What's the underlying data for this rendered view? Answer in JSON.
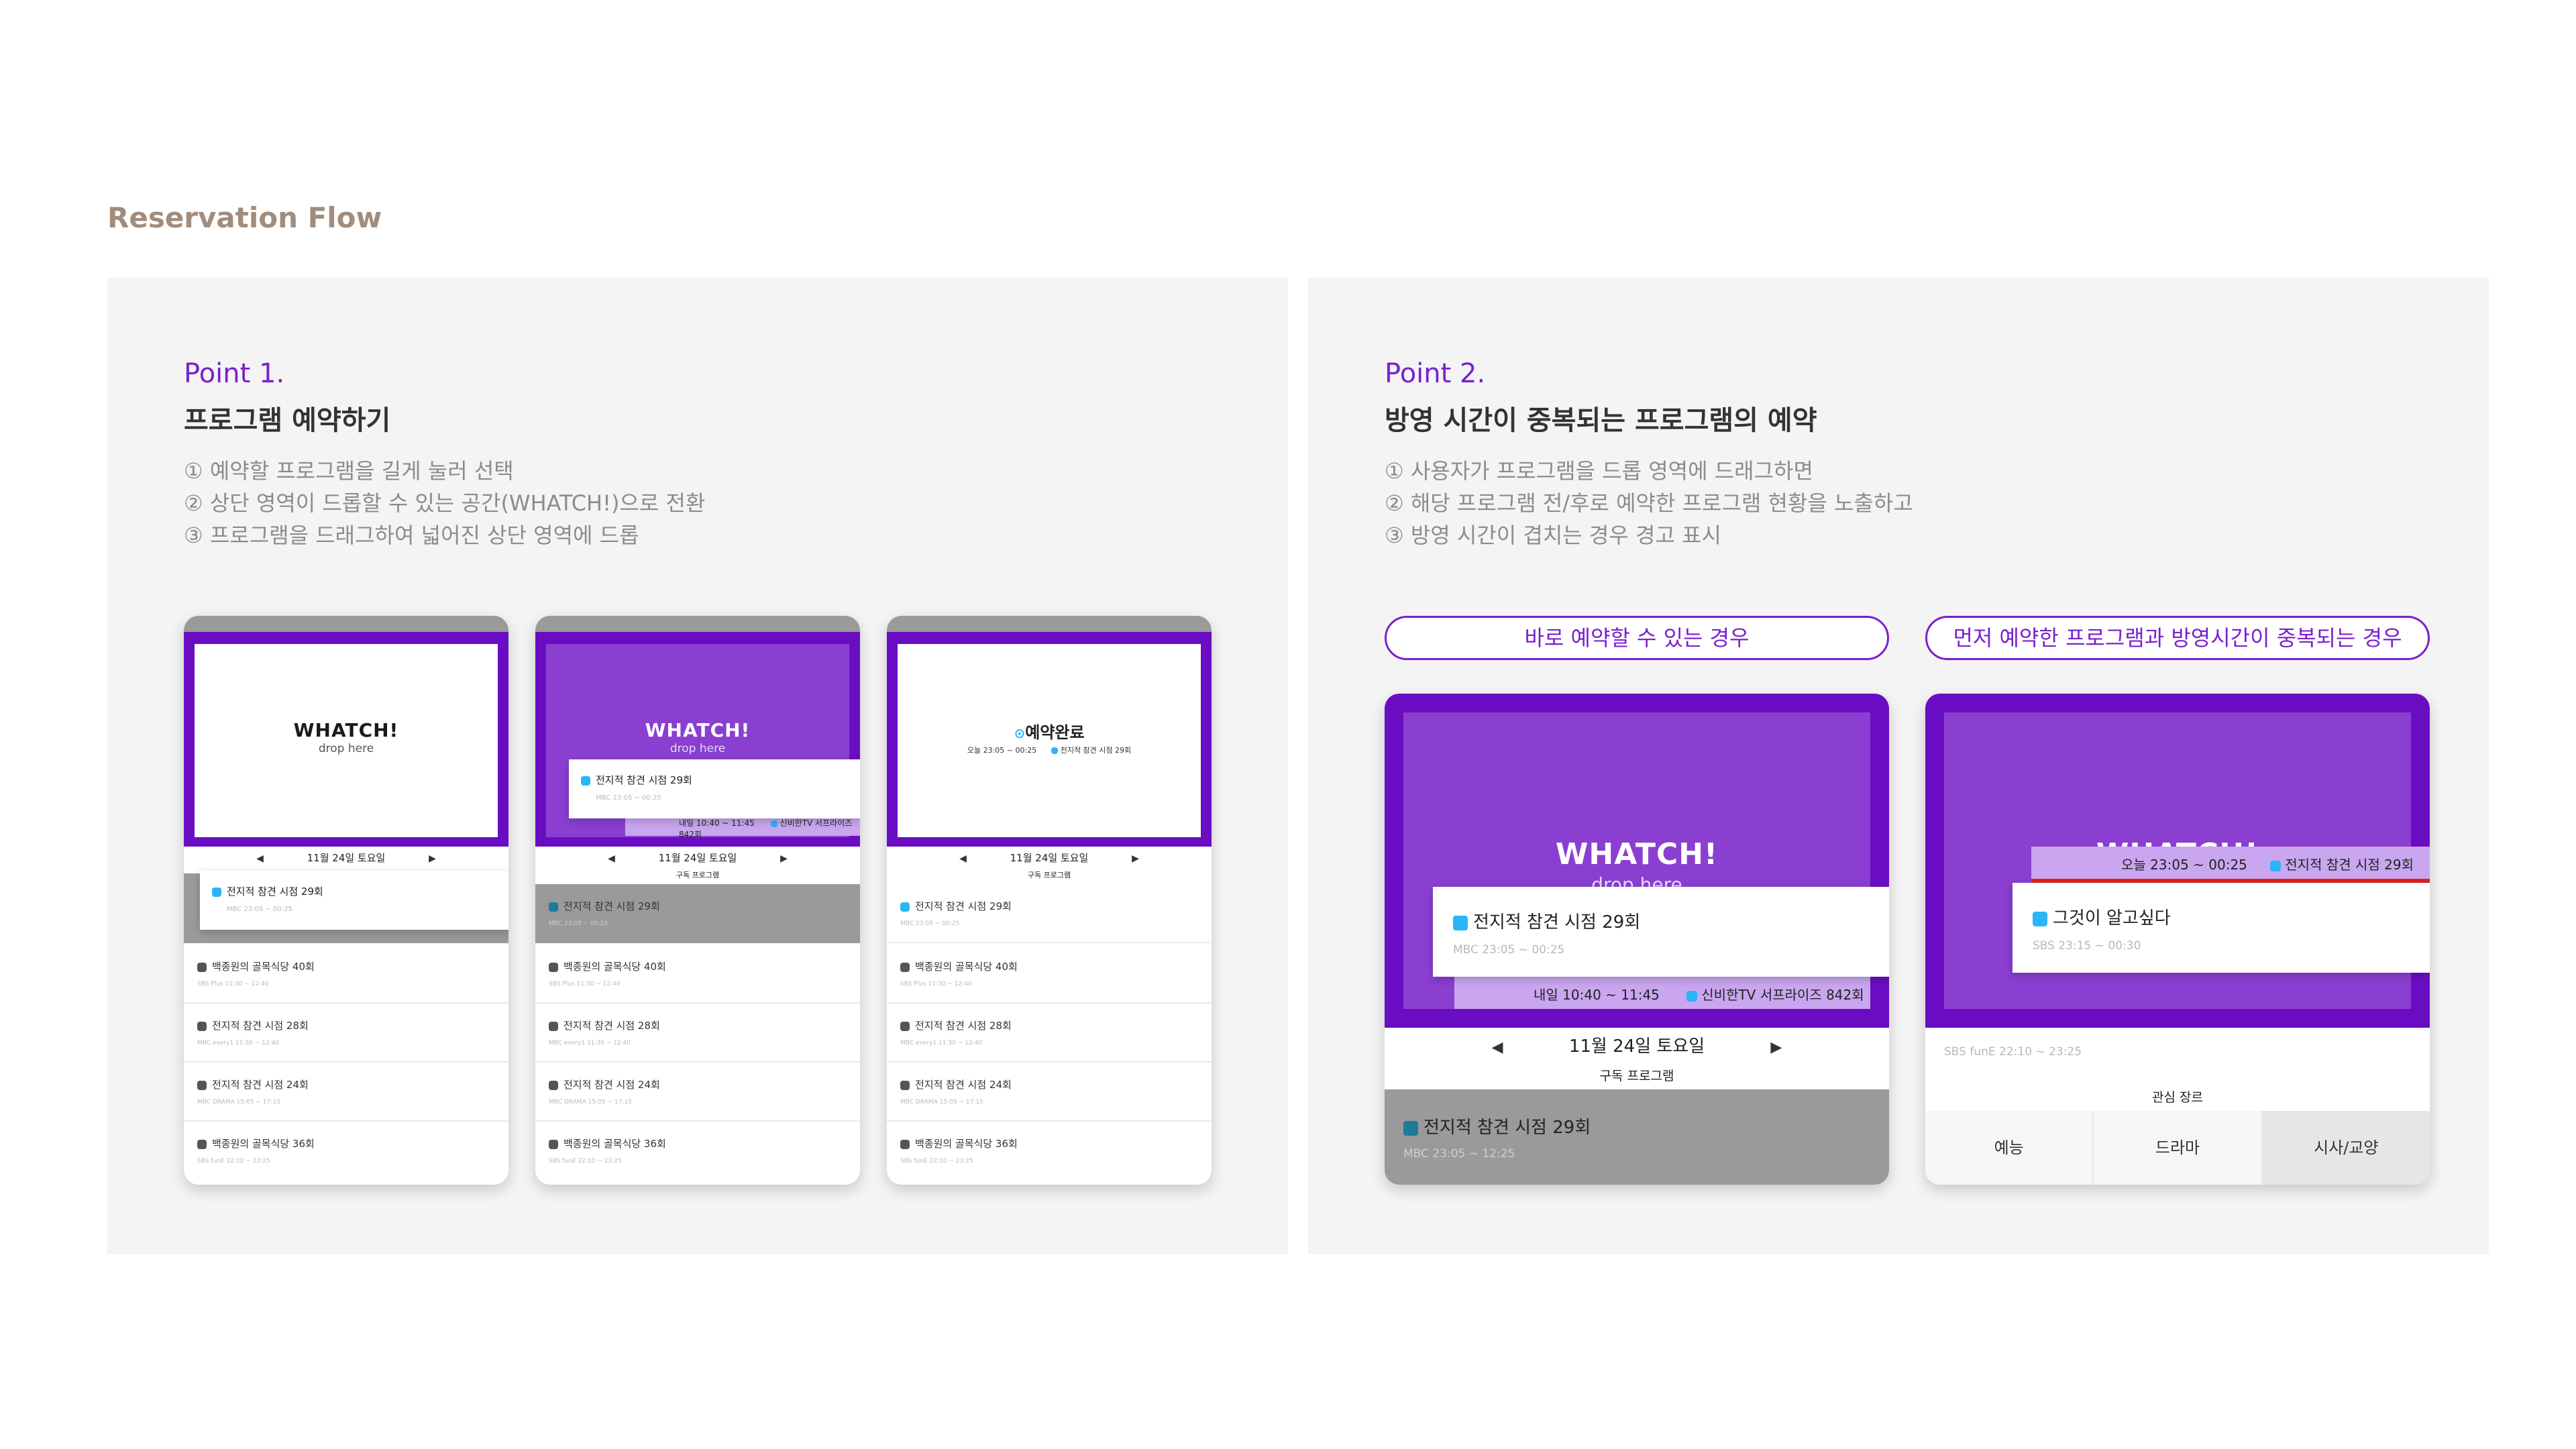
{
  "page_title": "Reservation Flow",
  "point1": {
    "label": "Point 1.",
    "heading": "프로그램 예약하기",
    "steps": [
      "① 예약할 프로그램을 길게 눌러 선택",
      "② 상단 영역이 드롭할 수 있는 공간(WHATCH!)으로 전환",
      "③ 프로그램을 드래그하여 넓어진 상단 영역에 드롭"
    ]
  },
  "point2": {
    "label": "Point 2.",
    "heading": "방영 시간이 중복되는 프로그램의 예약",
    "steps": [
      "① 사용자가 프로그램을 드롭 영역에 드래그하면",
      "② 해당 프로그램 전/후로 예약한 프로그램 현황을 노출하고",
      "③ 방영 시간이 겹치는 경우 경고 표시"
    ],
    "case_ok": "바로 예약할 수 있는 경우",
    "case_conflict": "먼저 예약한 프로그램과 방영시간이 중복되는 경우"
  },
  "app": {
    "logo": "WHATCH!",
    "drop_here": "drop here",
    "date": "11월 24일 토요일",
    "subscribe_label": "구독 프로그램",
    "interest_label": "관심 장르",
    "done_title": "예약완료",
    "done_time": "오늘 23:05 ~ 00:25",
    "done_program": "전지적 참견 시점 29회",
    "prev_arrow": "◀",
    "next_arrow": "▶",
    "dragged": {
      "title": "전지적 참견 시점 29회",
      "sub": "MBC 23:05 ~ 00:25"
    },
    "reserved_next": {
      "time": "내일 10:40 ~ 11:45",
      "program": "신비한TV 서프라이즈 842회"
    },
    "list": [
      {
        "title": "전지적 참견 시점 29회",
        "sub": "MBC 23:05 ~ 00:25"
      },
      {
        "title": "백종원의 골목식당 40회",
        "sub": "SBS Plus 11:30 ~ 12:40"
      },
      {
        "title": "전지적 참견 시점 28회",
        "sub": "MBC every1 11:30 ~ 12:40"
      },
      {
        "title": "전지적 참견 시점 24회",
        "sub": "MBC DRAMA 15:05 ~ 17:15"
      },
      {
        "title": "백종원의 골목식당 36회",
        "sub": "SBS funE 22:10 ~ 23:25"
      }
    ],
    "big_list_item": {
      "title": "전지적 참견 시점 29회",
      "sub": "MBC 23:05 ~ 12:25"
    },
    "conflict_card": {
      "title": "그것이 알고싶다",
      "sub": "SBS 23:15 ~ 00:30"
    },
    "conflict_reserved": {
      "time": "오늘 23:05 ~ 00:25",
      "program": "전지적 참견 시점 29회"
    },
    "behind_sub": "SBS funE 22:10 ~ 23:25",
    "genres": [
      "예능",
      "드라마",
      "시사/교양"
    ]
  },
  "colors": {
    "accent": "#7a1fcf",
    "purple_fill": "#8a3fd0",
    "warning": "#e02020",
    "title": "#a28c7c"
  }
}
